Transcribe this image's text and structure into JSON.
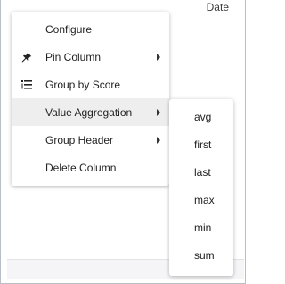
{
  "header": {
    "column_title": "Date"
  },
  "menu": {
    "items": [
      {
        "label": "Configure",
        "icon": "",
        "has_submenu": false
      },
      {
        "label": "Pin Column",
        "icon": "pin-icon",
        "has_submenu": true
      },
      {
        "label": "Group by Score",
        "icon": "group-list-icon",
        "has_submenu": false
      },
      {
        "label": "Value Aggregation",
        "icon": "",
        "has_submenu": true,
        "active": true
      },
      {
        "label": "Group Header",
        "icon": "",
        "has_submenu": true
      },
      {
        "label": "Delete Column",
        "icon": "",
        "has_submenu": false
      }
    ]
  },
  "submenu": {
    "items": [
      "avg",
      "first",
      "last",
      "max",
      "min",
      "sum"
    ]
  }
}
